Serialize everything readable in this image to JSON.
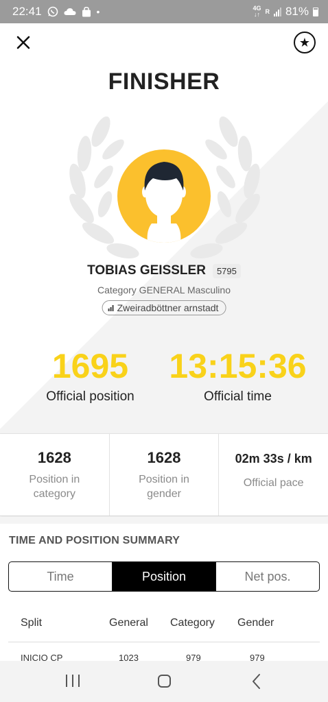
{
  "status_bar": {
    "time": "22:41",
    "network": "4G",
    "signal": "R",
    "battery": "81%"
  },
  "header": {
    "title": "FINISHER"
  },
  "runner": {
    "name": "TOBIAS GEISSLER",
    "bib": "5795",
    "category": "Category GENERAL Masculino",
    "club": "Zweiradböttner arnstadt"
  },
  "official": {
    "position_value": "1695",
    "position_label": "Official position",
    "time_value": "13:15:36",
    "time_label": "Official time"
  },
  "stats": [
    {
      "value": "1628",
      "label": "Position in category"
    },
    {
      "value": "1628",
      "label": "Position in gender"
    },
    {
      "value": "02m 33s / km",
      "label": "Official pace"
    }
  ],
  "summary": {
    "title": "TIME AND POSITION SUMMARY",
    "tabs": [
      "Time",
      "Position",
      "Net pos."
    ],
    "active_tab": "Position",
    "columns": [
      "Split",
      "General",
      "Category",
      "Gender"
    ],
    "rows": [
      {
        "split": "INICIO CP",
        "general": "1023",
        "category": "979",
        "gender": "979"
      }
    ]
  },
  "colors": {
    "accent_yellow": "#f9d21a",
    "avatar_yellow": "#fbc02d",
    "status_bar": "#9b9b9b"
  },
  "icons": {
    "close": "close-icon",
    "favorite": "star-icon",
    "club": "bar-chart-icon"
  }
}
